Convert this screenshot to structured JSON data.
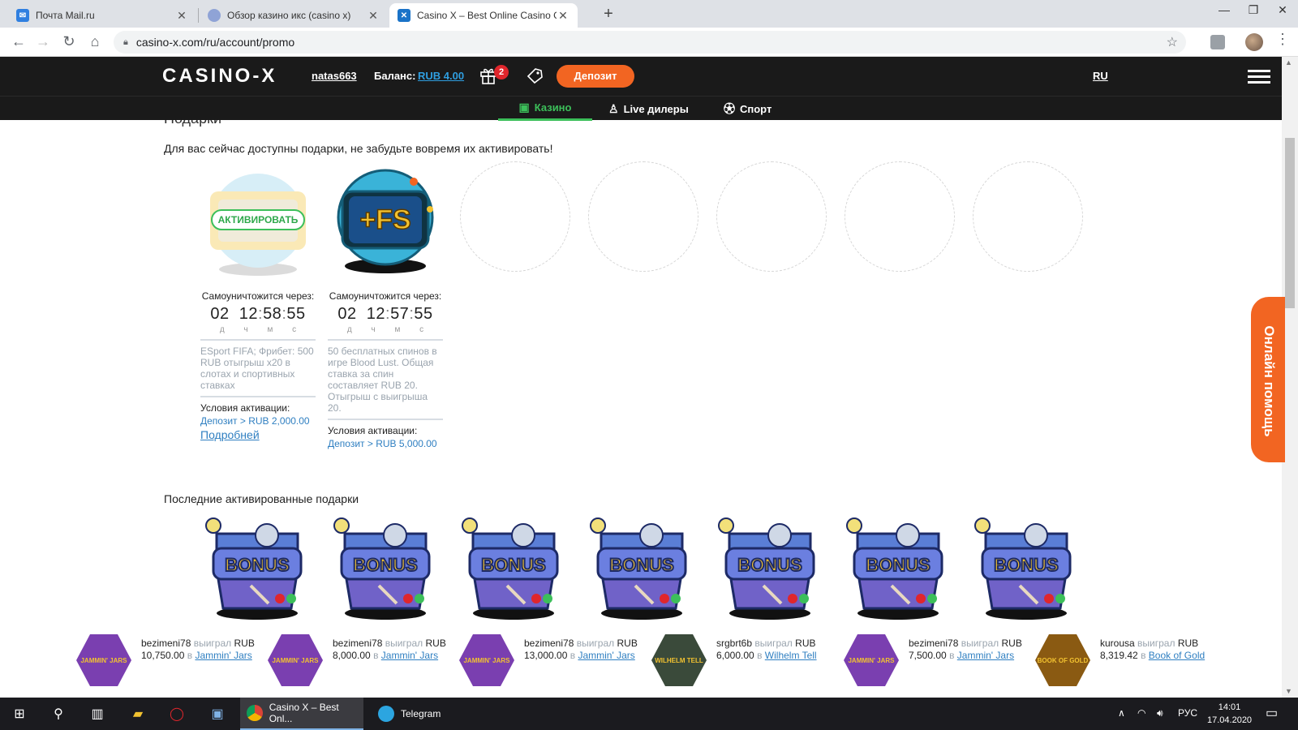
{
  "browser": {
    "tabs": [
      {
        "title": "Почта Mail.ru",
        "favicon_color": "#2f7fe0"
      },
      {
        "title": "Обзор казино икс (casino x)",
        "favicon_color": "#8fa3d6"
      },
      {
        "title": "Casino X – Best Online Casino Ga",
        "favicon_color": "#1a73c8"
      }
    ],
    "url": "casino-x.com/ru/account/promo"
  },
  "header": {
    "logo": "CASINO-X",
    "username": "natas663",
    "balance_label": "Баланс:",
    "balance_value": "RUB 4.00",
    "gift_count": "2",
    "deposit_label": "Депозит",
    "language": "RU"
  },
  "subnav": [
    {
      "label": "Казино",
      "icon": "slot-machine-icon",
      "active": true
    },
    {
      "label": "Live дилеры",
      "icon": "dealer-icon",
      "active": false
    },
    {
      "label": "Спорт",
      "icon": "soccer-ball-icon",
      "active": false
    }
  ],
  "page": {
    "heading": "Подарки",
    "intro": "Для вас сейчас доступны подарки, не забудьте вовремя их активировать!",
    "timer_label": "Самоуничтожится через:",
    "timer_units": [
      "д",
      "ч",
      "м",
      "с"
    ],
    "conditions_label": "Условия активации:",
    "more_link": "Подробней",
    "activate_label": "АКТИВИРОВАТЬ"
  },
  "gifts": [
    {
      "timer": {
        "d": "02",
        "h": "12",
        "m": "58",
        "s": "55"
      },
      "description": "ESport FIFA; Фрибет: 500 RUB отыгрыш x20 в слотах и спортивных ставках",
      "condition": "Депозит > RUB 2,000.00",
      "has_activate": true
    },
    {
      "timer": {
        "d": "02",
        "h": "12",
        "m": "57",
        "s": "55"
      },
      "description": "50 бесплатных спинов в игре Blood Lust. Общая ставка за спин составляет RUB 20. Отыгрыш с выигрыша 20.",
      "condition": "Депозит > RUB 5,000.00",
      "fs_label": "+FS",
      "has_activate": false
    }
  ],
  "chat_tab": "Онлайн помощь",
  "recent": {
    "title": "Последние активированные подарки",
    "bonus_label": "BONUS",
    "count": 7
  },
  "winners": [
    {
      "user": "bezimeni78",
      "won": "выиграл",
      "amount": "RUB 10,750.00",
      "in": "в",
      "game": "Jammin' Jars",
      "thumb": "#7a3fb0",
      "thumb_label": "JAMMIN' JARS"
    },
    {
      "user": "bezimeni78",
      "won": "выиграл",
      "amount": "RUB 8,000.00",
      "in": "в",
      "game": "Jammin' Jars",
      "thumb": "#7a3fb0",
      "thumb_label": "JAMMIN' JARS"
    },
    {
      "user": "bezimeni78",
      "won": "выиграл",
      "amount": "RUB 13,000.00",
      "in": "в",
      "game": "Jammin' Jars",
      "thumb": "#7a3fb0",
      "thumb_label": "JAMMIN' JARS"
    },
    {
      "user": "srgbrt6b",
      "won": "выиграл",
      "amount": "RUB 6,000.00",
      "in": "в",
      "game": "Wilhelm Tell",
      "thumb": "#3a4a3a",
      "thumb_label": "WILHELM TELL"
    },
    {
      "user": "bezimeni78",
      "won": "выиграл",
      "amount": "RUB 7,500.00",
      "in": "в",
      "game": "Jammin' Jars",
      "thumb": "#7a3fb0",
      "thumb_label": "JAMMIN' JARS"
    },
    {
      "user": "kurousa",
      "won": "выиграл",
      "amount": "RUB 8,319.42",
      "in": "в",
      "game": "Book of Gold",
      "thumb": "#8a5a12",
      "thumb_label": "BOOK OF GOLD"
    }
  ],
  "taskbar": {
    "active_app": "Casino X – Best Onl...",
    "telegram": "Telegram",
    "lang": "РУС",
    "time": "14:01",
    "date": "17.04.2020"
  },
  "colors": {
    "accent_orange": "#f26522",
    "accent_green": "#3cbf5a",
    "link_blue": "#2f7fc1",
    "header_bg": "#1a1a1a"
  }
}
